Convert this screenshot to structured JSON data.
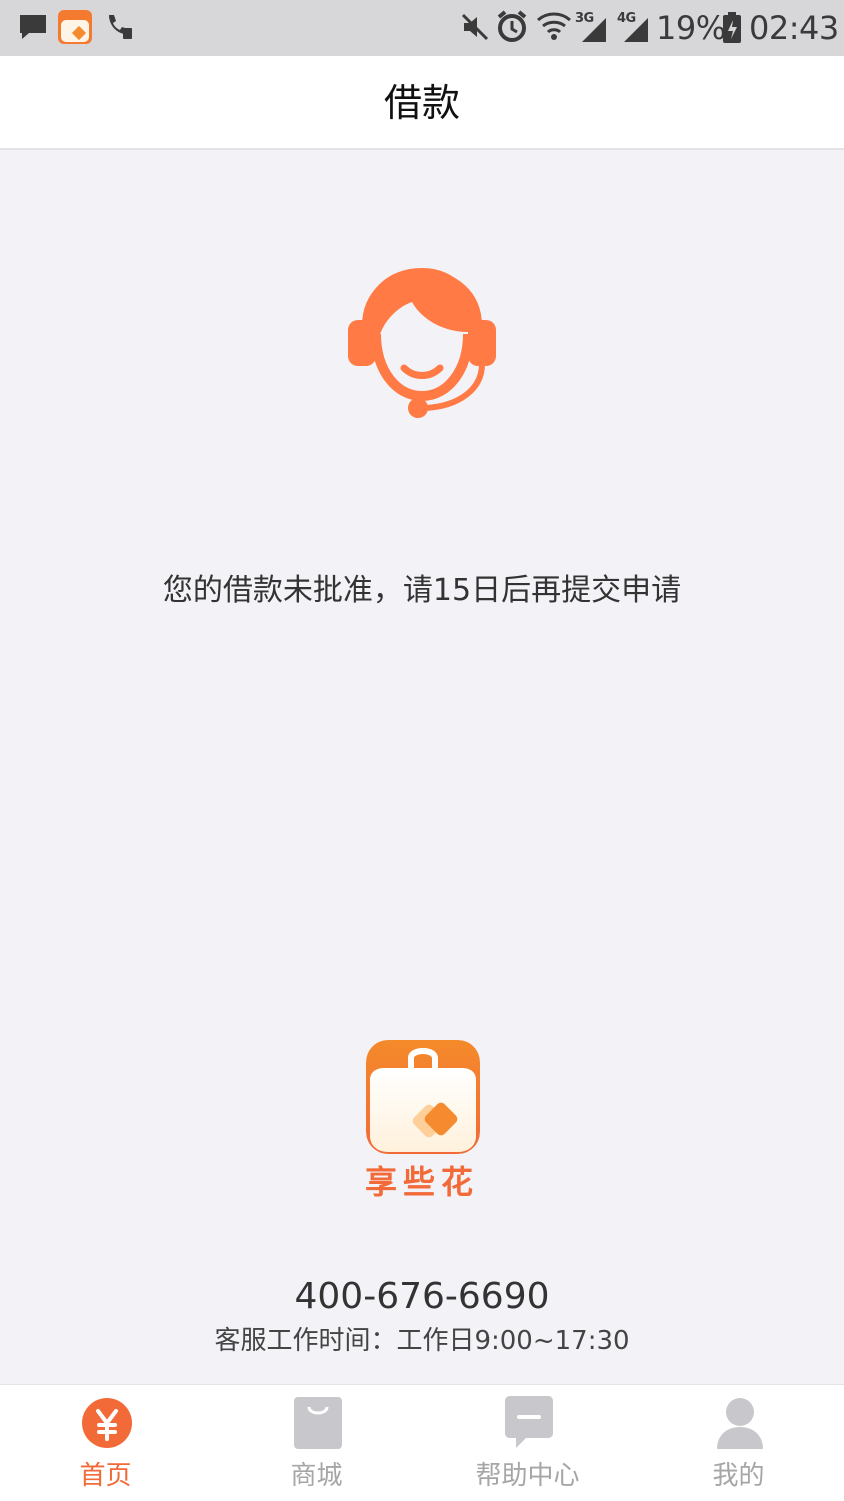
{
  "status_bar": {
    "network_3g": "3G",
    "network_4g": "4G",
    "battery": "19%",
    "time": "02:43",
    "icons": [
      "message-icon",
      "app-notification-icon",
      "wifi-call-icon",
      "mute-icon",
      "alarm-icon",
      "wifi-icon",
      "signal-icon",
      "battery-icon"
    ]
  },
  "header": {
    "title": "借款"
  },
  "main": {
    "icon": "customer-service-headset-icon",
    "message": "您的借款未批准，请15日后再提交申请"
  },
  "brand": {
    "name": "享些花",
    "logo": "shopping-bag-logo"
  },
  "service": {
    "phone": "400-676-6690",
    "hours": "客服工作时间：工作日9:00~17:30"
  },
  "nav": {
    "items": [
      {
        "label": "首页",
        "icon": "yen-coin-icon",
        "active": true
      },
      {
        "label": "商城",
        "icon": "shopping-bag-icon",
        "active": false
      },
      {
        "label": "帮助中心",
        "icon": "chat-bubble-icon",
        "active": false
      },
      {
        "label": "我的",
        "icon": "user-icon",
        "active": false
      }
    ]
  },
  "colors": {
    "accent": "#f26a38",
    "inactive": "#c8c8cc",
    "background": "#f3f3f7",
    "status_bar": "#d7d7d9"
  }
}
